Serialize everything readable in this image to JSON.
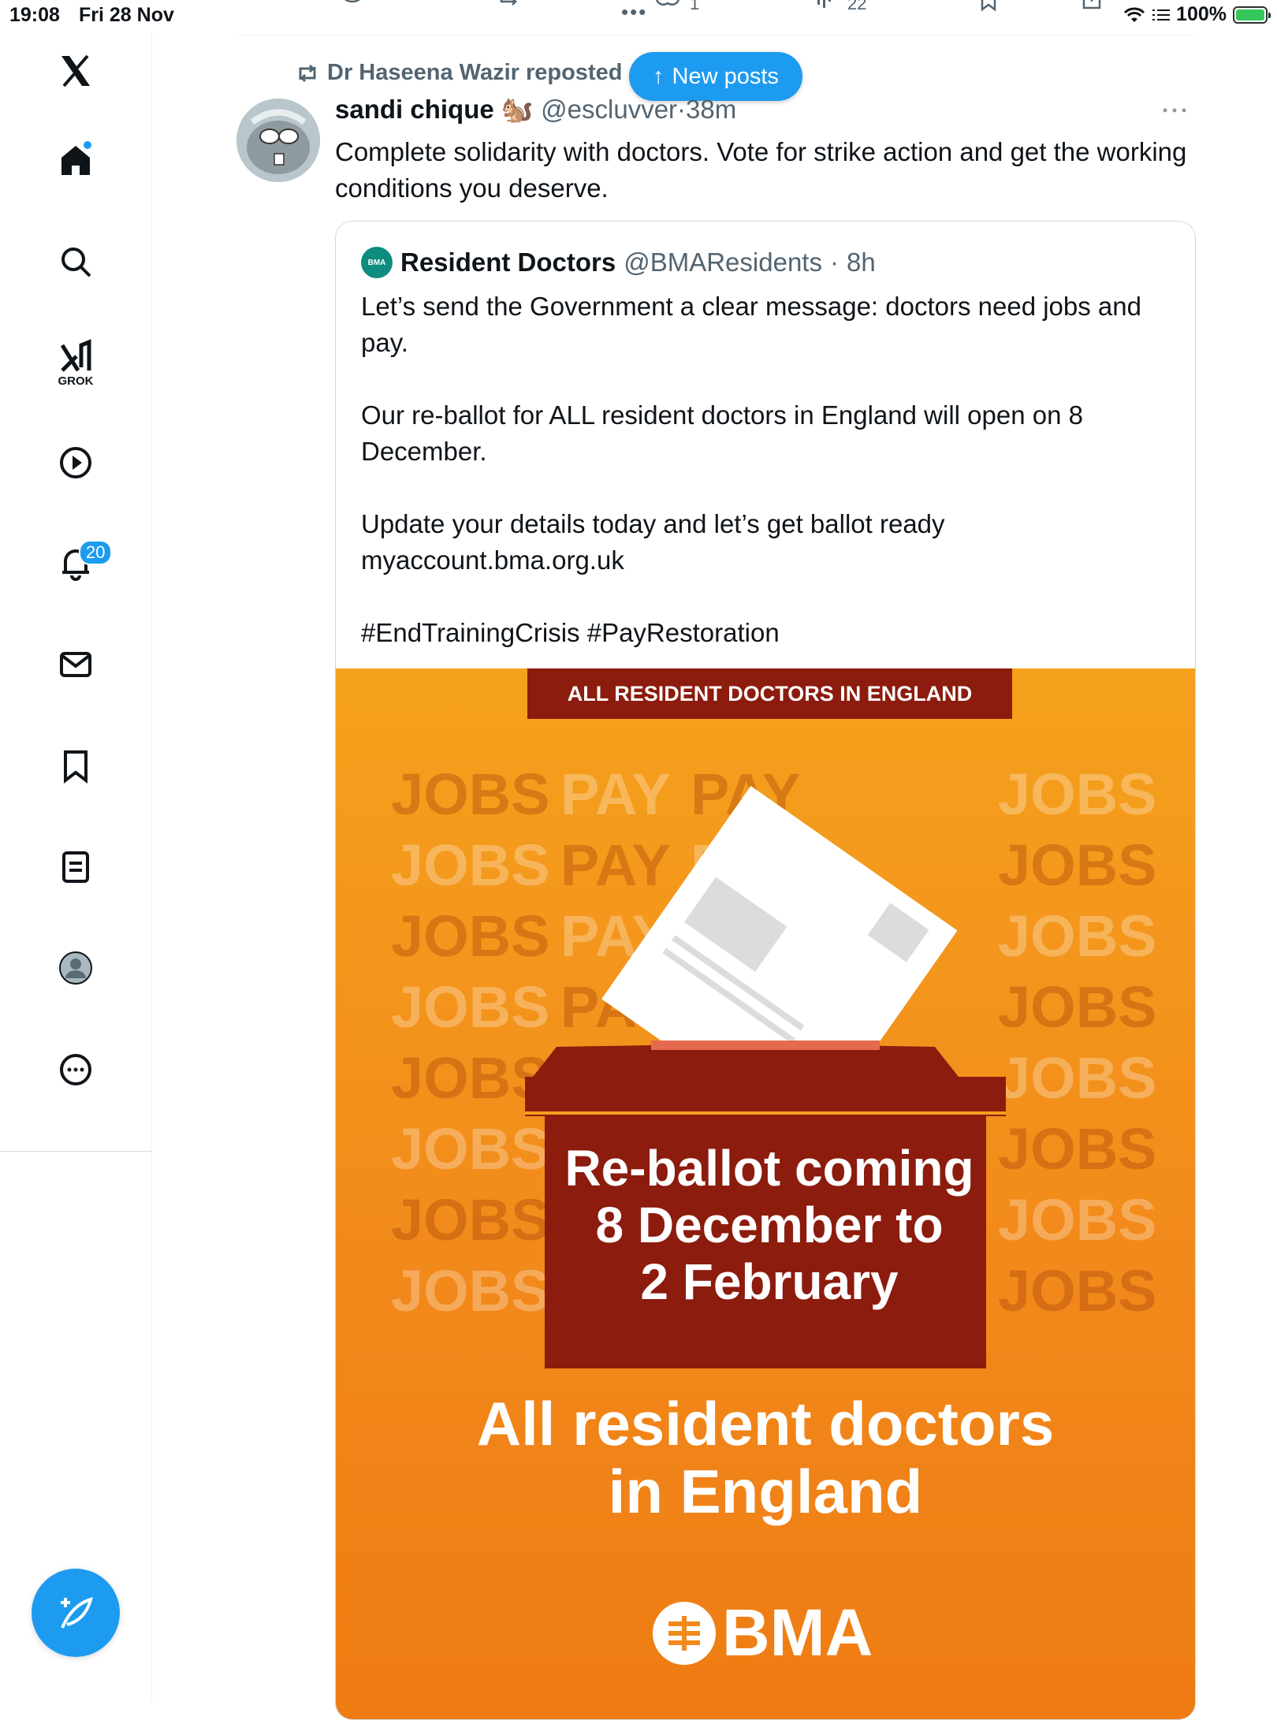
{
  "status_bar": {
    "time": "19:08",
    "date": "Fri 28 Nov",
    "battery": "100%"
  },
  "prev_tweet_actions": {
    "likes": "1",
    "views": "22"
  },
  "sidebar": {
    "notifications_badge": "20",
    "grok_label": "GROK"
  },
  "new_posts_pill": {
    "label": "New posts",
    "arrow": "↑"
  },
  "tweet": {
    "repost_by": "Dr Haseena Wazir reposted",
    "author_name": "sandi chique",
    "author_emoji": "🐿️",
    "author_handle": "@escluvver",
    "time": "38m",
    "text": "Complete solidarity with doctors. Vote for strike action and get the working conditions you deserve."
  },
  "quote": {
    "avatar_text": "BMA",
    "name": "Resident Doctors",
    "handle": "@BMAResidents",
    "time": "8h",
    "paragraphs": [
      "Let’s send the Government a clear message: doctors need jobs and pay.",
      "Our re-ballot for ALL resident doctors in England will open on 8 December.",
      "Update your details today and let’s get ballot ready myaccount.bma.org.uk",
      "#EndTrainingCrisis #PayRestoration"
    ]
  },
  "poster": {
    "banner": "ALL RESIDENT DOCTORS IN ENGLAND",
    "headline_1": "Re-ballot coming",
    "headline_2": "8 December to",
    "headline_3": "2 February",
    "sub_1": "All resident doctors",
    "sub_2": "in England",
    "logo_text": "BMA",
    "bg_words": [
      "JOBS",
      "PAY"
    ]
  },
  "colors": {
    "accent": "#1d9bf0",
    "poster_orange": "#f2891b",
    "poster_red": "#8c1c0e"
  }
}
